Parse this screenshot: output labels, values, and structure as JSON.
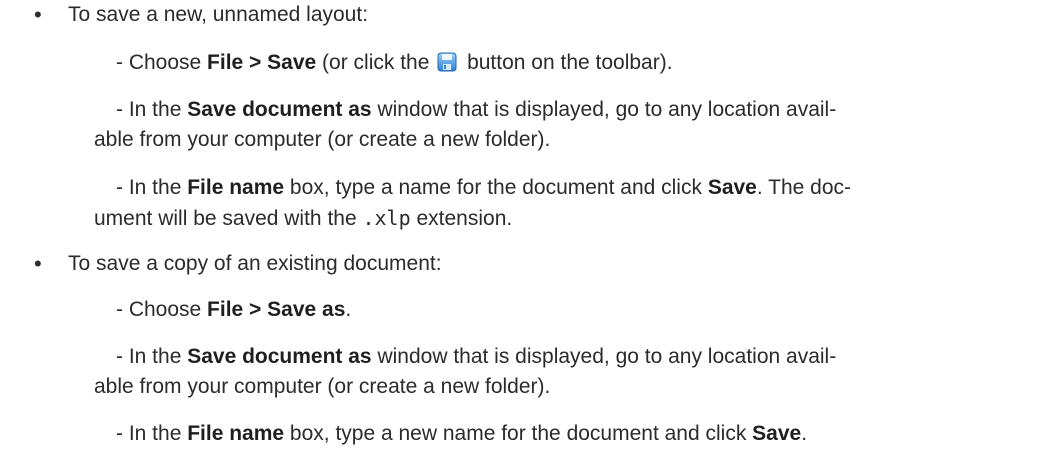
{
  "bullets": [
    {
      "symbol": "•",
      "text": "To save a new, unnamed layout:",
      "steps": [
        {
          "prefix": "- Choose ",
          "bold1": "File > Save",
          "mid": " (or click the ",
          "icon": "save-disk-icon",
          "suffix": " button on the toolbar)."
        },
        {
          "prefix": "- In the ",
          "bold1": "Save document as",
          "line1_rest": " window that is displayed, go to any location avail-",
          "line2": "able from your computer (or create a new folder)."
        },
        {
          "prefix": "- In the ",
          "bold1": "File name",
          "mid": " box, type a name for the document and click ",
          "bold2": "Save",
          "line1_rest": ". The doc-",
          "line2_prefix": "ument will be saved with the ",
          "line2_code": ".xlp",
          "line2_suffix": " extension."
        }
      ]
    },
    {
      "symbol": "•",
      "text": "To save a copy of an existing document:",
      "steps": [
        {
          "prefix": "- Choose ",
          "bold1": "File > Save as",
          "suffix": "."
        },
        {
          "prefix": "- In the ",
          "bold1": "Save document as",
          "line1_rest": " window that is displayed, go to any location avail-",
          "line2": "able from your computer (or create a new folder)."
        },
        {
          "prefix": "- In the ",
          "bold1": "File name",
          "mid": " box, type a new name for the document and click ",
          "bold2": "Save",
          "suffix": "."
        }
      ]
    }
  ],
  "colors": {
    "text": "#2b2b2b",
    "icon_blue": "#2f7fd6",
    "icon_light": "#9fd0f5"
  }
}
